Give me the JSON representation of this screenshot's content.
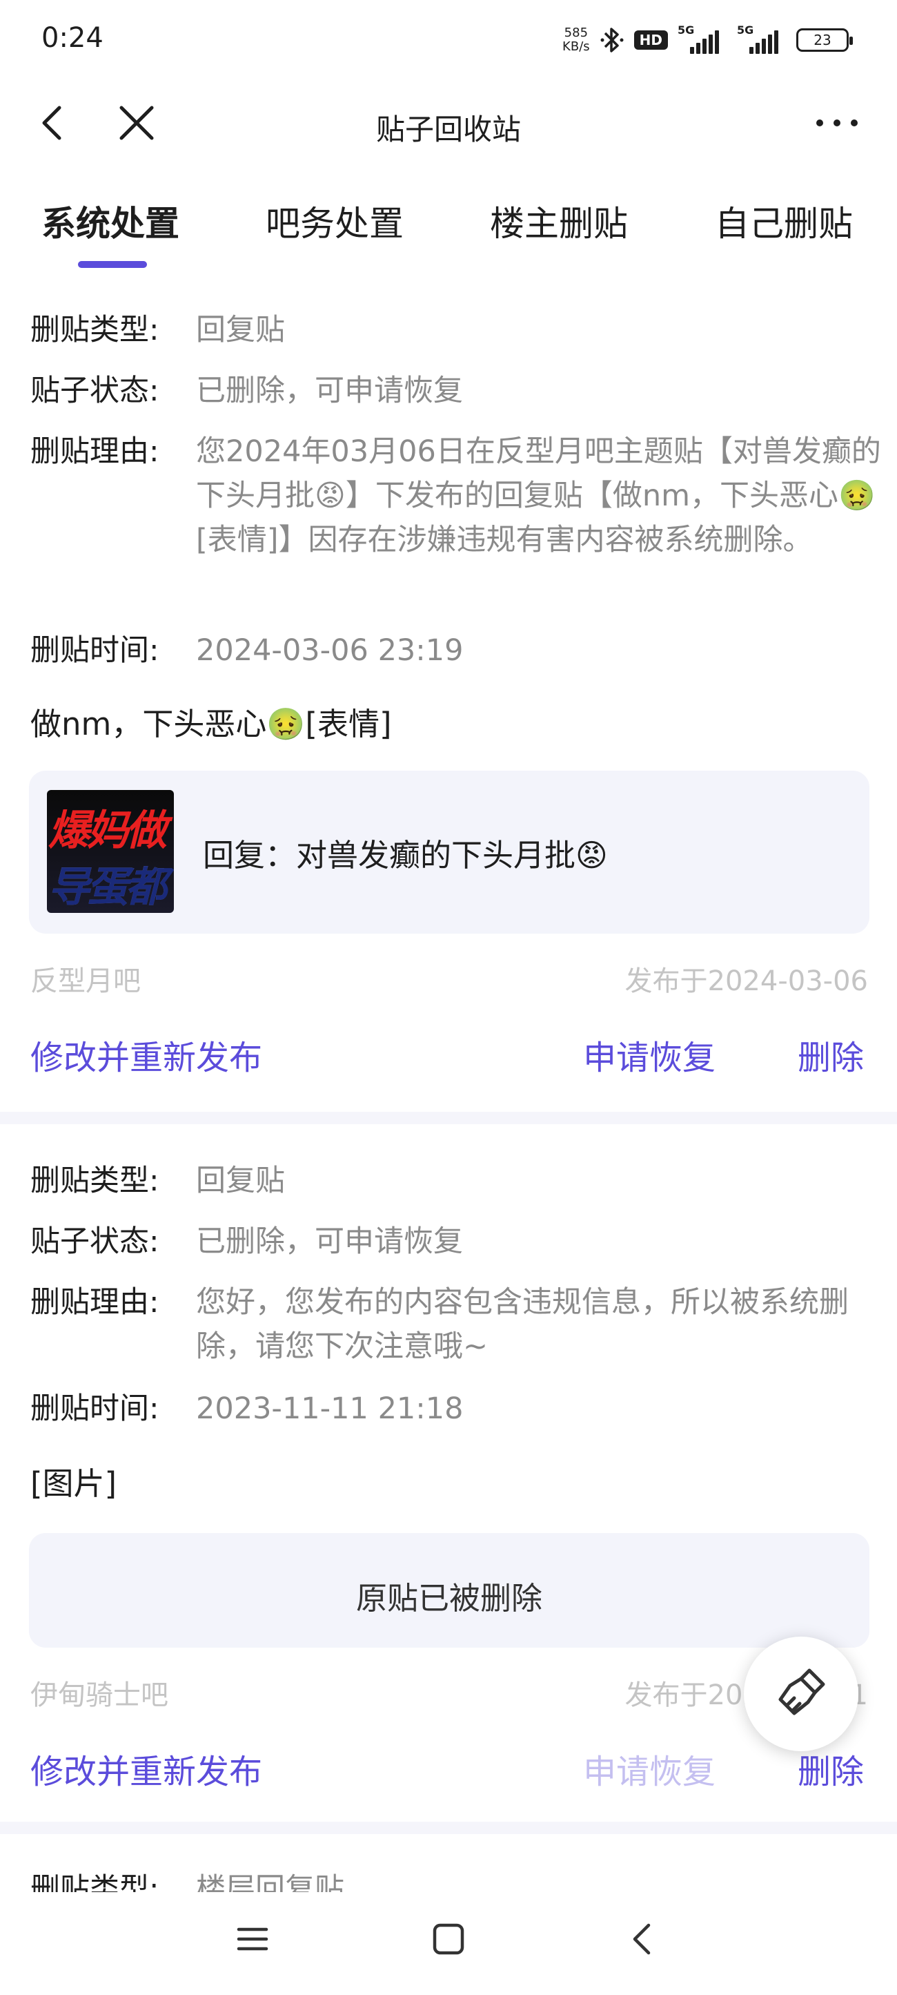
{
  "status_bar": {
    "time": "0:24",
    "net_speed_value": "585",
    "net_speed_unit": "KB/s",
    "hd_label": "HD",
    "signal1_label": "5G",
    "signal2_label": "5G",
    "battery": "23"
  },
  "nav": {
    "title": "贴子回收站"
  },
  "tabs": [
    {
      "label": "系统处置",
      "active": true
    },
    {
      "label": "吧务处置",
      "active": false
    },
    {
      "label": "楼主删贴",
      "active": false
    },
    {
      "label": "自己删贴",
      "active": false
    }
  ],
  "colors": {
    "accent": "#5b4cdb",
    "muted": "#8a8a8a",
    "faint": "#c4c4c4",
    "quote_bg": "#f3f4fb"
  },
  "labels": {
    "type": "删贴类型:",
    "status": "贴子状态:",
    "reason": "删贴理由:",
    "time": "删贴时间:"
  },
  "posts": [
    {
      "type": "回复贴",
      "status": "已删除，可申请恢复",
      "reason": "您2024年03月06日在反型月吧主题贴【对兽发癫的下头月批😡】下发布的回复贴【做nm，下头恶心🤢[表情]】因存在涉嫌违规有害内容被系统删除。",
      "time": "2024-03-06 23:19",
      "content": "做nm，下头恶心🤢[表情]",
      "quote": "回复：对兽发癫的下头月批😡",
      "thumb_line1": "爆妈做",
      "thumb_line2": "导蛋都",
      "forum": "反型月吧",
      "published": "发布于2024-03-06",
      "action_edit": "修改并重新发布",
      "action_restore": "申请恢复",
      "action_delete": "删除"
    },
    {
      "type": "回复贴",
      "status": "已删除，可申请恢复",
      "reason": "您好，您发布的内容包含违规信息，所以被系统删除，请您下次注意哦~",
      "time": "2023-11-11 21:18",
      "content": "[图片]",
      "quote": "原贴已被删除",
      "forum": "伊甸骑士吧",
      "published": "发布于2023-11-11",
      "action_edit": "修改并重新发布",
      "action_restore": "申请恢复",
      "action_delete": "删除"
    },
    {
      "type": "楼层回复贴"
    }
  ]
}
